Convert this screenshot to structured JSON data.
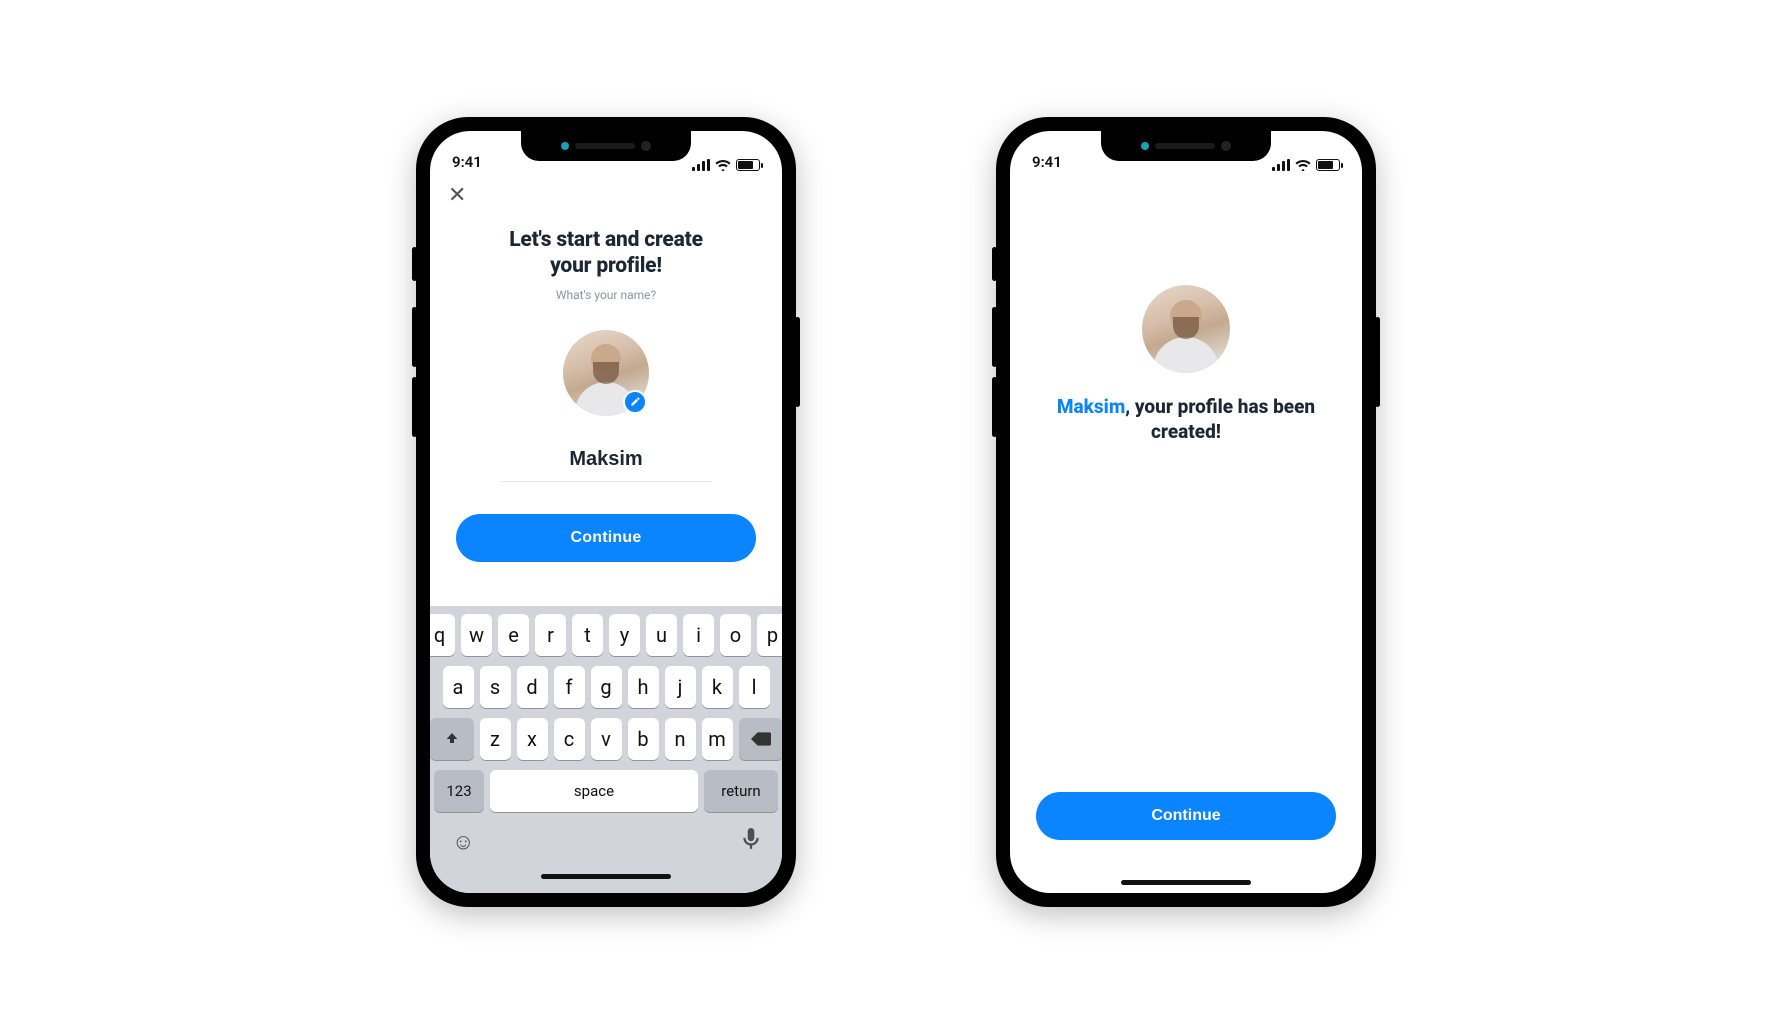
{
  "status": {
    "time": "9:41"
  },
  "screen1": {
    "title_line1": "Let's start and create",
    "title_line2": "your profile!",
    "subtitle": "What's your name?",
    "name_value": "Maksim",
    "continue_label": "Continue"
  },
  "screen2": {
    "name": "Maksim",
    "message_tail": ", your profile has been created!",
    "continue_label": "Continue"
  },
  "keyboard": {
    "row1": [
      "q",
      "w",
      "e",
      "r",
      "t",
      "y",
      "u",
      "i",
      "o",
      "p"
    ],
    "row2": [
      "a",
      "s",
      "d",
      "f",
      "g",
      "h",
      "j",
      "k",
      "l"
    ],
    "row3": [
      "z",
      "x",
      "c",
      "v",
      "b",
      "n",
      "m"
    ],
    "num_label": "123",
    "space_label": "space",
    "return_label": "return"
  },
  "colors": {
    "accent": "#0a84ff"
  }
}
